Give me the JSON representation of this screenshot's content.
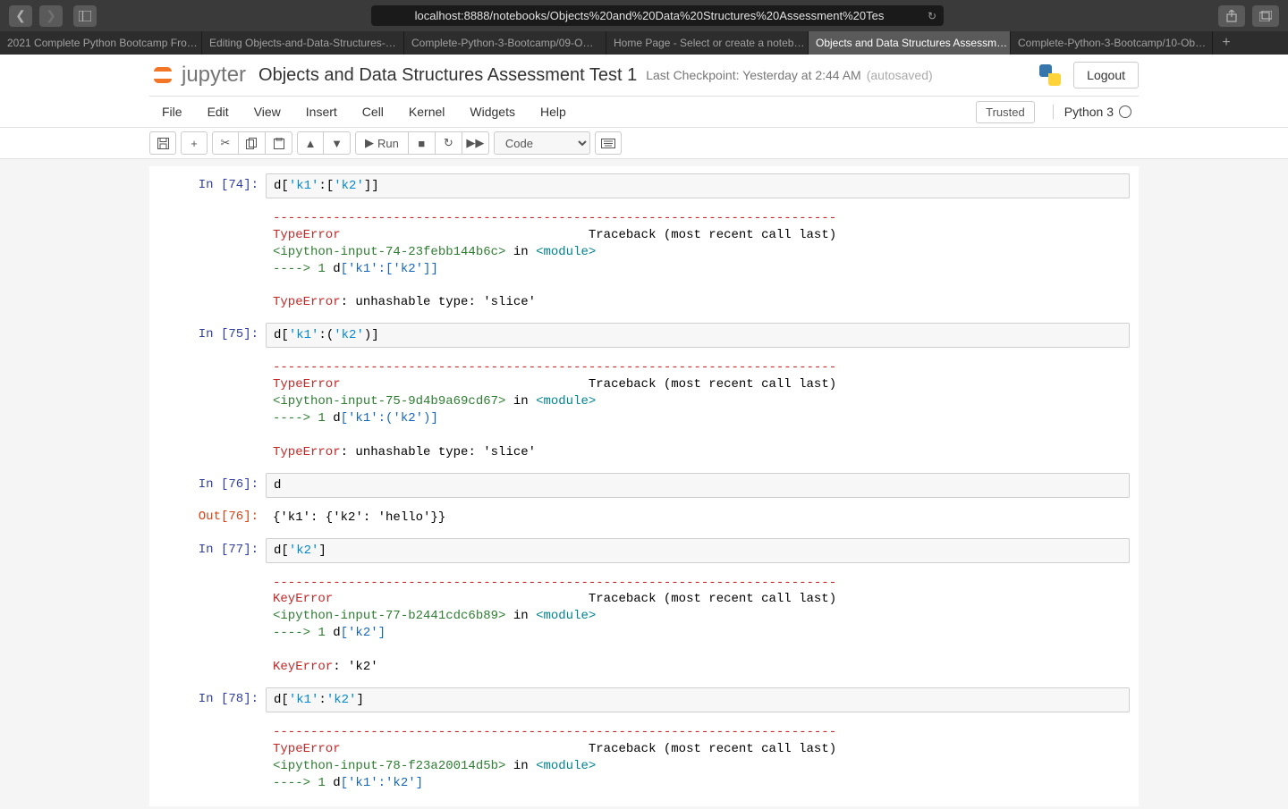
{
  "browser": {
    "url": "localhost:8888/notebooks/Objects%20and%20Data%20Structures%20Assessment%20Tes",
    "tabs": [
      "2021 Complete Python Bootcamp Fro…",
      "Editing Objects-and-Data-Structures-…",
      "Complete-Python-3-Bootcamp/09-O…",
      "Home Page - Select or create a noteb…",
      "Objects and Data Structures Assessm…",
      "Complete-Python-3-Bootcamp/10-Ob…"
    ],
    "active_tab": 4
  },
  "header": {
    "logo_text": "jupyter",
    "notebook_name": "Objects and Data Structures Assessment Test 1",
    "checkpoint": "Last Checkpoint: Yesterday at 2:44 AM",
    "autosaved": "(autosaved)",
    "logout": "Logout"
  },
  "menu": {
    "items": [
      "File",
      "Edit",
      "View",
      "Insert",
      "Cell",
      "Kernel",
      "Widgets",
      "Help"
    ],
    "trusted": "Trusted",
    "kernel": "Python 3"
  },
  "toolbar": {
    "run_label": "Run",
    "cell_type": "Code"
  },
  "cells": {
    "c74": {
      "prompt": "In [74]:",
      "sep": "---------------------------------------------------------------------------",
      "err_name": "TypeError",
      "traceback": "                                 Traceback (most recent call last)",
      "source": "<ipython-input-74-23febb144b6c>",
      "in_word": " in ",
      "module": "<module>",
      "arrow": "----> 1",
      "var": " d",
      "slice": "['k1':['k2']]",
      "msg": ": unhashable type: 'slice'"
    },
    "c75": {
      "prompt": "In [75]:",
      "sep": "---------------------------------------------------------------------------",
      "err_name": "TypeError",
      "traceback": "                                 Traceback (most recent call last)",
      "source": "<ipython-input-75-9d4b9a69cd67>",
      "in_word": " in ",
      "module": "<module>",
      "arrow": "----> 1",
      "var": " d",
      "slice": "['k1':('k2')]",
      "msg": ": unhashable type: 'slice'"
    },
    "c76": {
      "prompt": "In [76]:",
      "out_prompt": "Out[76]:",
      "code": "d",
      "output": "{'k1': {'k2': 'hello'}}"
    },
    "c77": {
      "prompt": "In [77]:",
      "sep": "---------------------------------------------------------------------------",
      "err_name": "KeyError",
      "traceback": "                                  Traceback (most recent call last)",
      "source": "<ipython-input-77-b2441cdc6b89>",
      "in_word": " in ",
      "module": "<module>",
      "arrow": "----> 1",
      "var": " d",
      "slice": "['k2']",
      "msg": ": 'k2'"
    },
    "c78": {
      "prompt": "In [78]:",
      "sep": "---------------------------------------------------------------------------",
      "err_name": "TypeError",
      "traceback": "                                 Traceback (most recent call last)",
      "source": "<ipython-input-78-f23a20014d5b>",
      "in_word": " in ",
      "module": "<module>",
      "arrow": "----> 1",
      "var": " d",
      "slice": "['k1':'k2']"
    }
  }
}
